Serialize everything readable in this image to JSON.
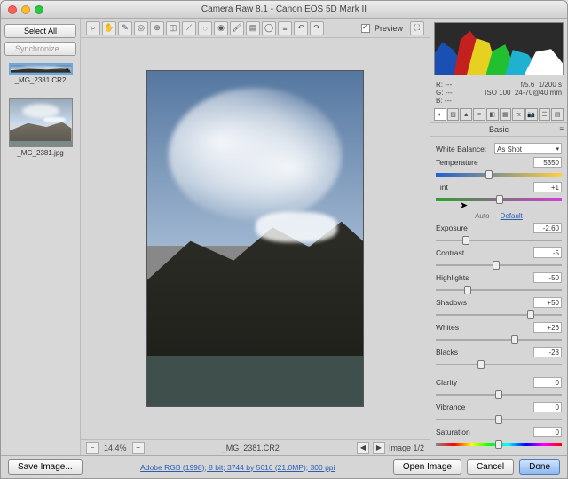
{
  "title": "Camera Raw 8.1  -  Canon EOS 5D Mark II",
  "filmstrip": {
    "select_all": "Select All",
    "synchronize": "Synchronize...",
    "thumbs": [
      {
        "name": "_MG_2381.CR2",
        "selected": true
      },
      {
        "name": "_MG_2381.jpg",
        "selected": false
      }
    ]
  },
  "toolbar": {
    "preview_label": "Preview"
  },
  "status": {
    "zoom": "14.4%",
    "filename": "_MG_2381.CR2",
    "nav": "Image 1/2"
  },
  "histogram": {
    "r": "---",
    "g": "---",
    "b": "---",
    "aperture": "f/5.6",
    "shutter": "1/200 s",
    "iso": "ISO 100",
    "lens": "24-70@40 mm"
  },
  "panel": {
    "title": "Basic",
    "wb_label": "White Balance:",
    "wb_value": "As Shot",
    "auto": "Auto",
    "default": "Default",
    "sliders": {
      "temperature": {
        "label": "Temperature",
        "value": "5350",
        "pos": 42
      },
      "tint": {
        "label": "Tint",
        "value": "+1",
        "pos": 51
      },
      "exposure": {
        "label": "Exposure",
        "value": "-2.60",
        "pos": 24
      },
      "contrast": {
        "label": "Contrast",
        "value": "-5",
        "pos": 48
      },
      "highlights": {
        "label": "Highlights",
        "value": "-50",
        "pos": 25
      },
      "shadows": {
        "label": "Shadows",
        "value": "+50",
        "pos": 75
      },
      "whites": {
        "label": "Whites",
        "value": "+26",
        "pos": 63
      },
      "blacks": {
        "label": "Blacks",
        "value": "-28",
        "pos": 36
      },
      "clarity": {
        "label": "Clarity",
        "value": "0",
        "pos": 50
      },
      "vibrance": {
        "label": "Vibrance",
        "value": "0",
        "pos": 50
      },
      "saturation": {
        "label": "Saturation",
        "value": "0",
        "pos": 50
      }
    }
  },
  "footer": {
    "save": "Save Image...",
    "link": "Adobe RGB (1998); 8 bit; 3744 by 5616 (21.0MP); 300 ppi",
    "open": "Open Image",
    "cancel": "Cancel",
    "done": "Done"
  }
}
